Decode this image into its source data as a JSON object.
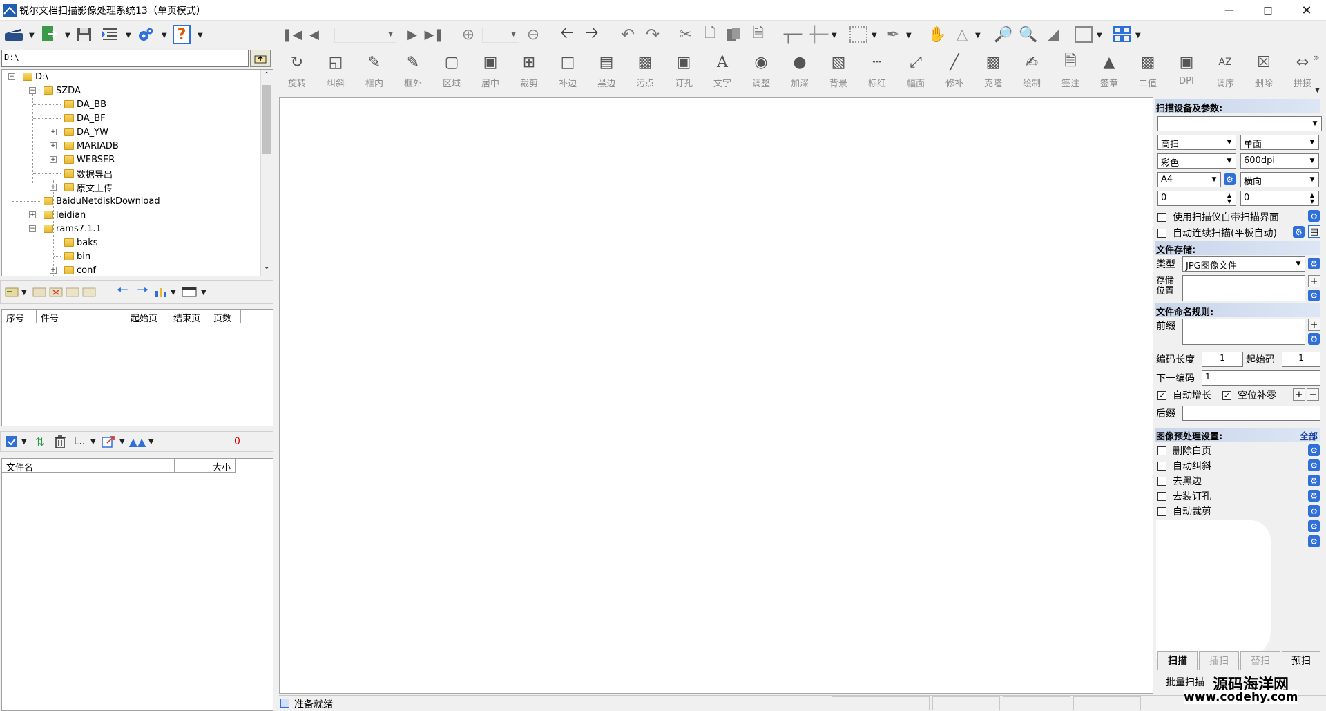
{
  "window": {
    "title": "锐尔文档扫描影像处理系统13（单页模式）"
  },
  "path_input": {
    "value": "D:\\"
  },
  "tree": {
    "items": [
      {
        "label": "D:\\"
      },
      {
        "label": "SZDA"
      },
      {
        "label": "DA_BB"
      },
      {
        "label": "DA_BF"
      },
      {
        "label": "DA_YW"
      },
      {
        "label": "MARIADB"
      },
      {
        "label": "WEBSER"
      },
      {
        "label": "数据导出"
      },
      {
        "label": "原文上传"
      },
      {
        "label": "BaiduNetdiskDownload"
      },
      {
        "label": "leidian"
      },
      {
        "label": "rams7.1.1"
      },
      {
        "label": "baks"
      },
      {
        "label": "bin"
      },
      {
        "label": "conf"
      }
    ]
  },
  "grid1": {
    "columns": [
      "序号",
      "件号",
      "起始页",
      "结束页",
      "页数"
    ]
  },
  "file_count": "0",
  "grid2": {
    "columns": [
      "文件名",
      "大小"
    ]
  },
  "ribbon": {
    "buttons": [
      "旋转",
      "纠斜",
      "框内",
      "框外",
      "区域",
      "居中",
      "裁剪",
      "补边",
      "黑边",
      "污点",
      "订孔",
      "文字",
      "调整",
      "加深",
      "背景",
      "标红",
      "幅面",
      "修补",
      "克隆",
      "绘制",
      "签注",
      "签章",
      "二值",
      "DPI",
      "调序",
      "删除",
      "拼接"
    ]
  },
  "status": {
    "text": "准备就绪"
  },
  "scan_panel": {
    "section_device": "扫描设备及参数:",
    "device_value": "",
    "scan_mode": "高扫",
    "side": "单面",
    "color": "彩色",
    "dpi": "600dpi",
    "paper": "A4",
    "orientation": "横向",
    "num1": "0",
    "num2": "0",
    "use_scanner_ui": "使用扫描仪自带扫描界面",
    "auto_continuous": "自动连续扫描(平板自动)",
    "section_storage": "文件存储:",
    "type_label": "类型",
    "type_value": "JPG图像文件",
    "save_label": "存储位置",
    "section_naming": "文件命名规则:",
    "prefix_label": "前缀",
    "code_length_label": "编码长度",
    "code_length_value": "1",
    "start_code_label": "起始码",
    "start_code_value": "1",
    "next_code_label": "下一编码",
    "next_code_value": "1",
    "auto_increment": "自动增长",
    "pad_zero": "空位补零",
    "suffix_label": "后缀",
    "section_preprocess": "图像预处理设置:",
    "all_link": "全部",
    "pre_items": [
      "删除白页",
      "自动纠斜",
      "去黑边",
      "去装订孔",
      "自动裁剪"
    ],
    "tabs": [
      "扫描",
      "插扫",
      "替扫",
      "预扫"
    ],
    "batch_scan": "批量扫描",
    "watermark": "源码海洋网",
    "watermark_url": "www.codehy.com"
  },
  "colors": {
    "accent": "#2f6fd8",
    "section_bg": "#c9d5ea",
    "count_red": "#d40000"
  }
}
